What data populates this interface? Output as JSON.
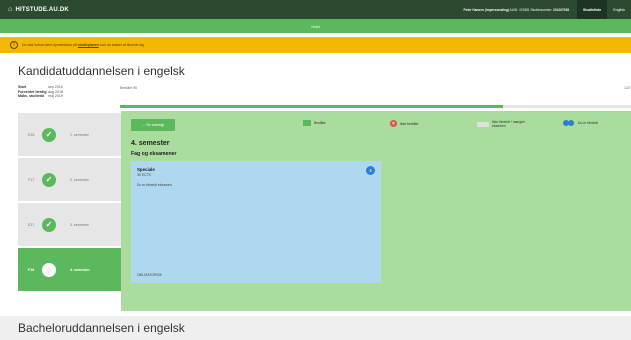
{
  "topbar": {
    "brand": "HITSTUDE.AU.DK",
    "user_name": "Peter Hansen (impersonating)",
    "user_auid": "AUID: 474581",
    "student_no_label": "Studienummer:",
    "student_no": "201207928",
    "links": [
      {
        "label": "Studieliste",
        "active": true
      },
      {
        "label": "English",
        "active": false
      }
    ]
  },
  "greenbar": {
    "text": "Hold"
  },
  "warning": {
    "text_before": "Du skal fortsat være opmærksom på ",
    "link": "studieplanen",
    "text_after": " som du ønsker at tilmelde dig"
  },
  "page": {
    "title": "Kandidatuddannelsen i engelsk",
    "meta": [
      {
        "key": "Start",
        "value": "sep 2016"
      },
      {
        "key": "Forventet færdig",
        "value": "aug 2018"
      },
      {
        "key": "Maks. studietid",
        "value": "maj 2019"
      }
    ]
  },
  "progress": {
    "label": "Bestået 90",
    "max": "120",
    "fraction": 0.75
  },
  "semesters": [
    {
      "code": "E16",
      "label": "1. semester",
      "status": "done"
    },
    {
      "code": "F17",
      "label": "2. semester",
      "status": "done"
    },
    {
      "code": "E17",
      "label": "3. semester",
      "status": "done"
    },
    {
      "code": "F18",
      "label": "4. semester",
      "status": "current"
    }
  ],
  "panel": {
    "back_label": "← Se oversigt",
    "legend": {
      "passed": "Bestået",
      "failed": "Ikke bestået",
      "not_registered": "Ikke tilmeldt / mangler eksamen",
      "registered": "Du er tilmeldt"
    },
    "semester_title": "4. semester",
    "section_title": "Fag og eksamener",
    "course": {
      "title": "Speciale",
      "ects": "30 ECTS",
      "note": "Du er tilmeldt eksamen.",
      "badge": "4",
      "type": "OBLIGATORISK"
    }
  },
  "bachelor": {
    "title": "Bacheloruddannelsen i engelsk"
  }
}
